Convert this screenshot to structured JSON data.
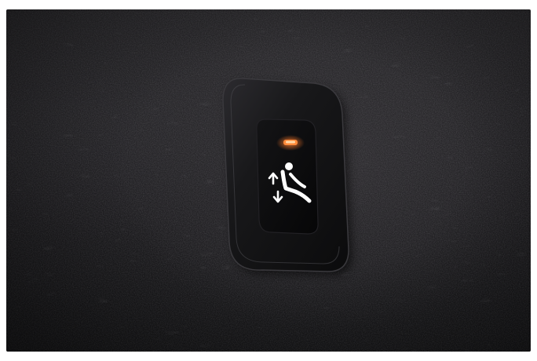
{
  "scene": {
    "subject": "illuminated-seat-fold-button",
    "background": "dark-carpet-panel",
    "indicator_color": "#ff7a2a",
    "icon_color": "#ffffff",
    "bezel_color": "#141416",
    "carpet_color": "#262528"
  },
  "button": {
    "icon": "seat-fold-arrows-icon",
    "indicator": "status-led-icon"
  }
}
